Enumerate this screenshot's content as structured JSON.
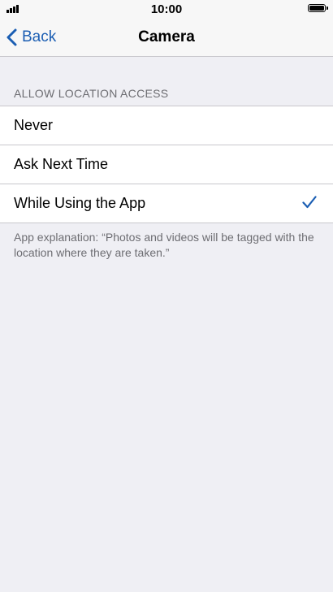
{
  "status_bar": {
    "time": "10:00",
    "signal_icon": "cellular-signal-icon",
    "battery_icon": "battery-icon"
  },
  "nav": {
    "back_label": "Back",
    "back_icon": "chevron-left-icon",
    "title": "Camera"
  },
  "location": {
    "section_header": "ALLOW LOCATION ACCESS",
    "options": [
      {
        "label": "Never",
        "selected": false
      },
      {
        "label": "Ask Next Time",
        "selected": false
      },
      {
        "label": "While Using the App",
        "selected": true
      }
    ],
    "checkmark_icon": "checkmark-icon",
    "footer": "App explanation: “Photos and videos will be tagged with the location where they are taken.”"
  },
  "colors": {
    "accent": "#1B5EB3",
    "background": "#EFEFF4",
    "bar_background": "#F7F7F7",
    "separator": "#C8C7CC",
    "secondary_text": "#6D6D72"
  }
}
